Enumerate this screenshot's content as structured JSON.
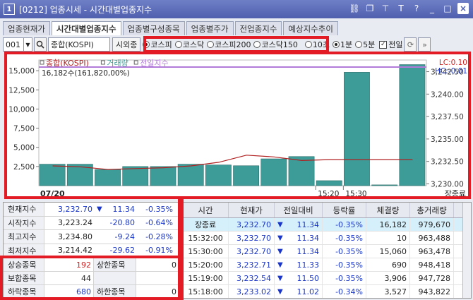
{
  "window": {
    "title": "[0212] 업종시세 - 시간대별업종지수",
    "app_icon": "1"
  },
  "tabs": [
    "업종현재가",
    "시간대별업종지수",
    "업종별구성종목",
    "업종별주가",
    "전업종지수",
    "예상지수추이"
  ],
  "toolbar": {
    "code": "001",
    "name": "종합(KOSPI)",
    "overseas_btn": "시외종",
    "markets": [
      "코스피",
      "코스닥",
      "코스피200",
      "코스닥150"
    ],
    "intervals": [
      "10초",
      "1분",
      "5분"
    ],
    "prev_day_label": "전일"
  },
  "chart_data": {
    "type": "bar",
    "legend": [
      "종합(KOSPI)",
      "거래량",
      "전일지수"
    ],
    "tooltip": "16,182수(161,820,00%)",
    "x_labels": [
      "07/20",
      "15:20",
      "15:30"
    ],
    "volume_axis_ticks": [
      "15,000",
      "12,500",
      "10,000",
      "7,500",
      "5,000",
      "2,500"
    ],
    "index_axis_ticks": [
      "3,242.50",
      "3,240.00",
      "3,237.50",
      "3,235.00",
      "3,232.50",
      "3,230.00"
    ],
    "lc": "LC:0.10",
    "hc": "HC:-0.01",
    "bottom_right_label": "장종료",
    "volume": [
      2800,
      2800,
      2100,
      2500,
      2500,
      2800,
      2700,
      2600,
      3500,
      3800,
      650,
      14800,
      100,
      15800
    ],
    "index": [
      3232.0,
      3231.9,
      3231.6,
      3231.7,
      3231.8,
      3232.0,
      3232.4,
      3233.2,
      3233.0,
      3232.6,
      3232.7,
      3232.7,
      3232.7,
      3232.7
    ]
  },
  "summary": {
    "rows": [
      {
        "label": "현재지수",
        "value": "3,232.70",
        "change": "11.34",
        "rate": "-0.35%"
      },
      {
        "label": "시작지수",
        "value": "3,223.24",
        "change": "-20.80",
        "rate": "-0.64%"
      },
      {
        "label": "최고지수",
        "value": "3,234.80",
        "change": "-9.24",
        "rate": "-0.28%"
      },
      {
        "label": "최저지수",
        "value": "3,214.42",
        "change": "-29.62",
        "rate": "-0.91%"
      }
    ]
  },
  "breadth": {
    "rows": [
      {
        "label": "상승종목",
        "value": "192",
        "label2": "상한종목",
        "value2": "0"
      },
      {
        "label": "보합종목",
        "value": "44",
        "label2": "",
        "value2": ""
      },
      {
        "label": "하락종목",
        "value": "680",
        "label2": "하한종목",
        "value2": "0"
      }
    ]
  },
  "grid": {
    "headers": [
      "시간",
      "현재가",
      "전일대비",
      "등락률",
      "체결량",
      "총거래량"
    ],
    "rows": [
      {
        "time": "장종료",
        "price": "3,232.70",
        "diff": "11.34",
        "rate": "-0.35%",
        "vol": "16,182",
        "total": "979,670"
      },
      {
        "time": "15:32:00",
        "price": "3,232.70",
        "diff": "11.34",
        "rate": "-0.35%",
        "vol": "10",
        "total": "963,488"
      },
      {
        "time": "15:30:00",
        "price": "3,232.70",
        "diff": "11.34",
        "rate": "-0.35%",
        "vol": "15,060",
        "total": "963,478"
      },
      {
        "time": "15:20:00",
        "price": "3,232.71",
        "diff": "11.33",
        "rate": "-0.35%",
        "vol": "690",
        "total": "948,418"
      },
      {
        "time": "15:19:00",
        "price": "3,232.54",
        "diff": "11.50",
        "rate": "-0.35%",
        "vol": "3,906",
        "total": "947,728"
      },
      {
        "time": "15:18:00",
        "price": "3,233.02",
        "diff": "11.02",
        "rate": "-0.34%",
        "vol": "3,527",
        "total": "943,822"
      }
    ]
  },
  "colors": {
    "bar": "#3d9c98",
    "index_line": "#b02020",
    "prev_line": "#b27bd9",
    "accent_red": "#e21b24",
    "down_blue": "#1a36c8"
  }
}
